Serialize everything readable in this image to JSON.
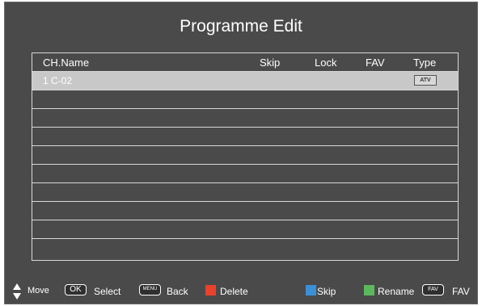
{
  "title": "Programme Edit",
  "columns": {
    "name": "CH.Name",
    "skip": "Skip",
    "lock": "Lock",
    "fav": "FAV",
    "type": "Type"
  },
  "rows": [
    {
      "name": "1 C-02",
      "type": "ATV"
    },
    {
      "name": "",
      "type": ""
    },
    {
      "name": "",
      "type": ""
    },
    {
      "name": "",
      "type": ""
    },
    {
      "name": "",
      "type": ""
    },
    {
      "name": "",
      "type": ""
    },
    {
      "name": "",
      "type": ""
    },
    {
      "name": "",
      "type": ""
    },
    {
      "name": "",
      "type": ""
    },
    {
      "name": "",
      "type": ""
    }
  ],
  "footer": {
    "move": "Move",
    "ok_key": "OK",
    "select": "Select",
    "menu_key": "MENU",
    "back": "Back",
    "delete": "Delete",
    "skip": "Skip",
    "rename": "Rename",
    "fav_key": "FAV",
    "fav": "FAV"
  },
  "colors": {
    "delete": "#e8412c",
    "skip": "#3a8fd6",
    "rename": "#5cb85c",
    "selected_row": "#c8c8c8"
  }
}
